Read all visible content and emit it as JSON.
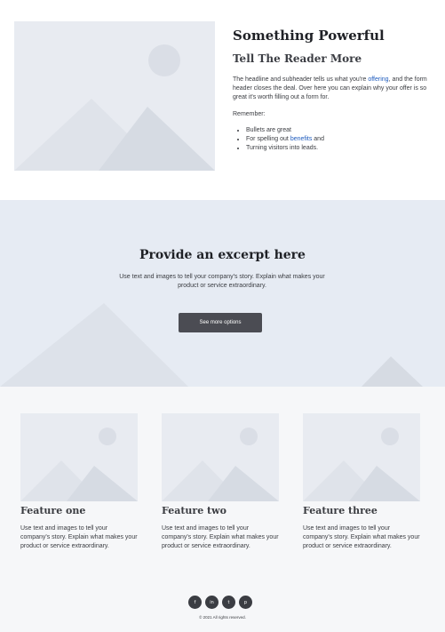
{
  "hero": {
    "title": "Something Powerful",
    "subtitle": "Tell The Reader More",
    "body_part1": "The headline and subheader tells us what you're ",
    "body_link": "offering",
    "body_part2": ", and the form header closes the deal. Over here you can explain why your offer is so great it's worth filling out a form for.",
    "remember": "Remember:",
    "bullets": {
      "b1": "Bullets are great",
      "b2_part1": "For spelling out ",
      "b2_link": "benefits",
      "b2_part2": " and",
      "b3": "Turning visitors into leads."
    }
  },
  "band": {
    "title": "Provide an excerpt here",
    "body": "Use text and images to tell your company's story. Explain what makes your product or service extraordinary.",
    "button_label": "See more options"
  },
  "features": [
    {
      "title": "Feature one",
      "body": "Use text and images to tell your company's story. Explain what makes your product or service extraordinary."
    },
    {
      "title": "Feature two",
      "body": "Use text and images to tell your company's story. Explain what makes your product or service extraordinary."
    },
    {
      "title": "Feature three",
      "body": "Use text and images to tell your company's story. Explain what makes your product or service extraordinary."
    }
  ],
  "footer": {
    "socials": [
      {
        "icon": "facebook-icon",
        "glyph": "f"
      },
      {
        "icon": "linkedin-icon",
        "glyph": "in"
      },
      {
        "icon": "twitter-icon",
        "glyph": "t"
      },
      {
        "icon": "pinterest-icon",
        "glyph": "p"
      }
    ],
    "copyright": "© 2021 All rights reserved."
  },
  "colors": {
    "placeholder_bg": "#e8ebf1",
    "placeholder_shape": "#dadee6",
    "band_bg": "#e6ebf3",
    "button_bg": "#4b4c53",
    "link": "#1e5bbd"
  }
}
